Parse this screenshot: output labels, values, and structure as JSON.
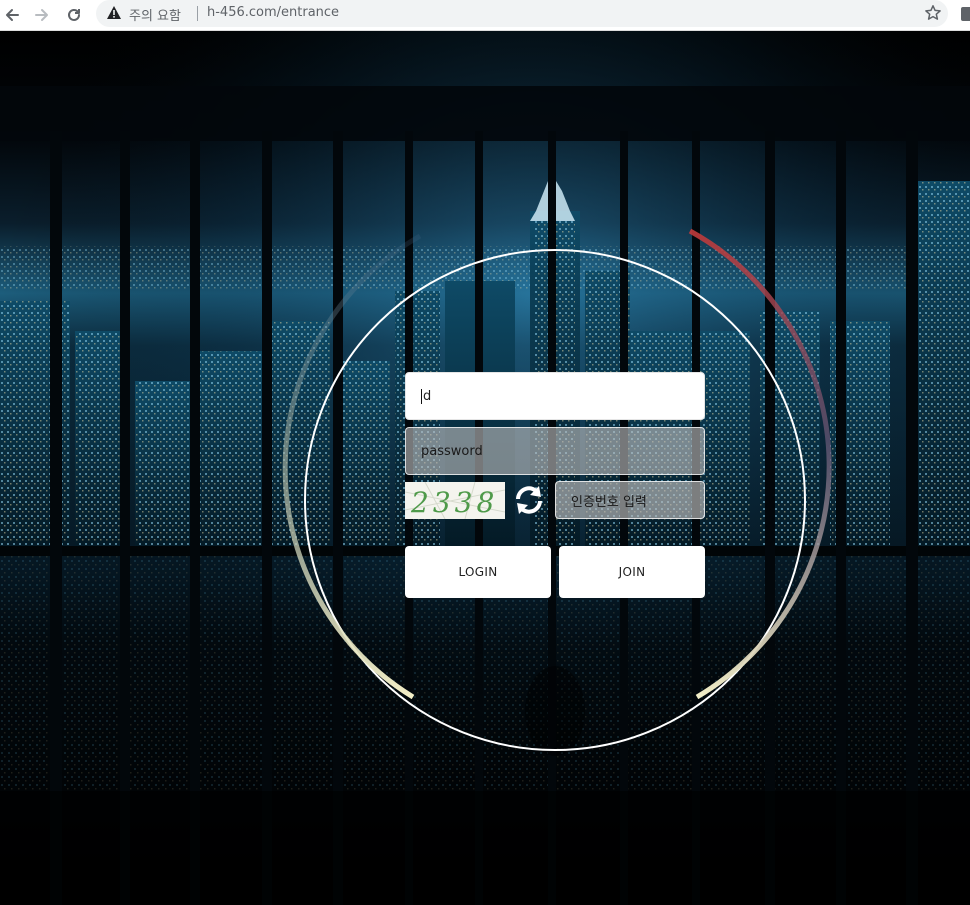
{
  "browser": {
    "security_label": "주의 요함",
    "url": "h-456.com/entrance"
  },
  "login": {
    "id_placeholder": "id",
    "id_value": "d",
    "password_placeholder": "password",
    "captcha_text": "2338",
    "captcha_placeholder": "인증번호 입력",
    "login_label": "LOGIN",
    "join_label": "JOIN"
  },
  "colors": {
    "background": "#000000",
    "field_bg": "#ffffff",
    "button_bg": "#ffffff",
    "ring": "#ffffff",
    "arc_cream": "#f3efc8",
    "arc_red": "#c23a3a",
    "city_glow": "#1e6f9a"
  },
  "icons": [
    "back-arrow-icon",
    "forward-arrow-icon",
    "reload-icon",
    "warning-icon",
    "star-icon",
    "refresh-icon"
  ]
}
